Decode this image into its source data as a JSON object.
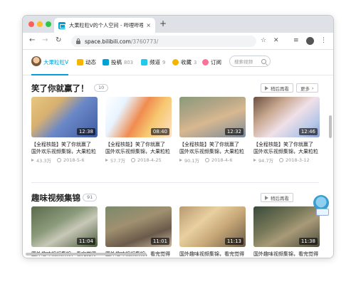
{
  "browser": {
    "tab_title": "大果粒粒V的个人空间 - 哔哩哔哩",
    "tab_close": "×",
    "new_tab": "+",
    "back": "←",
    "forward": "→",
    "reload": "↻",
    "url_host": "space.bilibili.com",
    "url_path": "/3760773/",
    "icons": [
      "lock-icon",
      "star-icon",
      "extension-icon",
      "reading-list-icon",
      "profile-icon",
      "menu-icon"
    ],
    "star": "☆",
    "ext": "✕",
    "list": "≡",
    "menu": "⋮"
  },
  "subnav": {
    "username": "大果粒粒V",
    "items": [
      {
        "label": "动态",
        "count": "",
        "color": "#f7b500"
      },
      {
        "label": "投稿",
        "count": "803",
        "color": "#00a1d6"
      },
      {
        "label": "频道",
        "count": "9",
        "color": "#23c9ed"
      },
      {
        "label": "收藏",
        "count": "3",
        "color": "#f5b400"
      },
      {
        "label": "订阅",
        "count": "",
        "color": "#fb7299"
      }
    ],
    "search_placeholder": "搜索视频"
  },
  "sections": [
    {
      "title": "笑了你就赢了！",
      "badge": "10",
      "later_label": "稍后再看",
      "more_label": "更多",
      "more_arrow": "›",
      "cards": [
        {
          "duration": "12:38",
          "title": "【全程核能】笑了你就赢了 国外欢乐视频集锦，大果粒粒",
          "plays": "43.3万",
          "date": "2018-5-6"
        },
        {
          "duration": "08:40",
          "title": "【全程核能】笑了你就赢了 国外欢乐视频集锦，大果粒粒",
          "plays": "57.7万",
          "date": "2018-4-25"
        },
        {
          "duration": "12:32",
          "title": "【全程核能】笑了你就赢了 国外欢乐视频集锦，大果粒粒",
          "plays": "90.1万",
          "date": "2018-4-6"
        },
        {
          "duration": "12:46",
          "title": "【全程核能】笑了你就赢了 国外欢乐视频集锦，大果粒粒",
          "plays": "94.7万",
          "date": "2018-3-12"
        }
      ]
    },
    {
      "title": "趣味视频集锦",
      "badge": "91",
      "later_label": "稍后再看",
      "cards": [
        {
          "duration": "11:04",
          "title": "国外趣味视频集锦，看完觉得整个世界都是那么欢乐！#90"
        },
        {
          "duration": "11:01",
          "title": "国外趣味视频集锦，看完觉得整个世界都是那么欢乐！#89"
        },
        {
          "duration": "11:13",
          "title": "国外趣味视频集锦，看完觉得整个世界都是那么欢乐！#88"
        },
        {
          "duration": "11:38",
          "title": "国外趣味视频集锦，看完觉得整个世界都是那么欢乐！#87"
        }
      ]
    }
  ],
  "colors": {
    "accent": "#00a1d6",
    "pink": "#fb7299"
  }
}
